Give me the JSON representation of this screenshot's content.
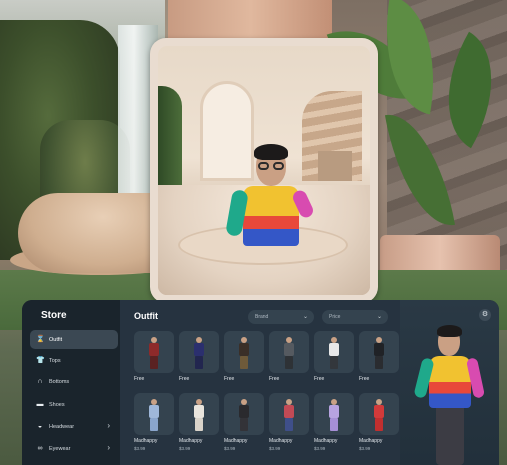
{
  "store": {
    "title": "Store",
    "sidebar": [
      {
        "label": "Outfit",
        "icon": "outfit-icon",
        "active": true
      },
      {
        "label": "Tops",
        "icon": "tops-icon",
        "active": false
      },
      {
        "label": "Bottoms",
        "icon": "bottoms-icon",
        "active": false
      },
      {
        "label": "Shoes",
        "icon": "shoes-icon",
        "active": false
      },
      {
        "label": "Headwear",
        "icon": "headwear-icon",
        "active": false,
        "has_submenu": true
      },
      {
        "label": "Eyewear",
        "icon": "eyewear-icon",
        "active": false,
        "has_submenu": true
      }
    ]
  },
  "main": {
    "title": "Outfit",
    "filters": {
      "brand": {
        "placeholder": "Brand"
      },
      "price": {
        "placeholder": "Price"
      }
    },
    "row1": [
      {
        "label": "Free",
        "price": "",
        "top": "#8e2a2a",
        "bottom": "#5a2222"
      },
      {
        "label": "Free",
        "price": "",
        "top": "#2b2f6e",
        "bottom": "#22264f"
      },
      {
        "label": "Free",
        "price": "",
        "top": "#3a2f28",
        "bottom": "#6e5a3a"
      },
      {
        "label": "Free",
        "price": "",
        "top": "#555a60",
        "bottom": "#2e3236"
      },
      {
        "label": "Free",
        "price": "",
        "top": "#e8e8e8",
        "bottom": "#33373c"
      },
      {
        "label": "Free",
        "price": "",
        "top": "#202226",
        "bottom": "#2a2c30"
      }
    ],
    "row2": [
      {
        "label": "Madhappy",
        "price": "$3.99",
        "top": "#9fb7d9",
        "bottom": "#8aa5cc"
      },
      {
        "label": "Madhappy",
        "price": "$3.99",
        "top": "#e9e4dc",
        "bottom": "#d9d3c9"
      },
      {
        "label": "Madhappy",
        "price": "$3.99",
        "top": "#2a2a2e",
        "bottom": "#333338"
      },
      {
        "label": "Madhappy",
        "price": "$3.99",
        "top": "#c24a55",
        "bottom": "#3f4f8a"
      },
      {
        "label": "Madhappy",
        "price": "$3.99",
        "top": "#b7a3e0",
        "bottom": "#a68fd6"
      },
      {
        "label": "Madhappy",
        "price": "$3.99",
        "top": "#d23a3a",
        "bottom": "#c12f2f"
      }
    ]
  },
  "colors": {
    "panel": "#1f2a33",
    "card": "#34434f",
    "accent_active": "#3b4853",
    "hoodie_yellow": "#f1c230",
    "hoodie_red": "#e8483a",
    "hoodie_blue": "#3457c7",
    "sleeve_teal": "#1fa98b",
    "sleeve_pink": "#d84bb0"
  },
  "icons": {
    "settings": "settings-icon"
  }
}
